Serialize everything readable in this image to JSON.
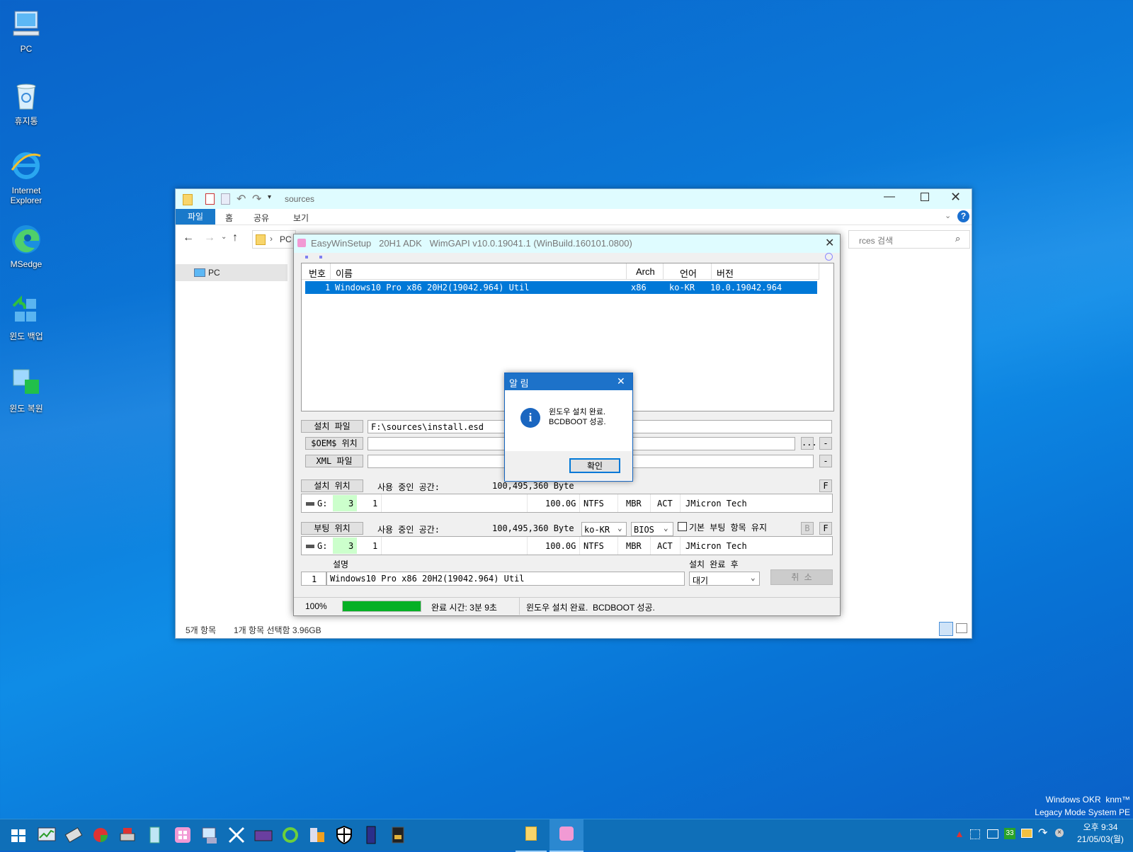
{
  "desktop": {
    "icons": [
      {
        "label": "PC"
      },
      {
        "label": "휴지통"
      },
      {
        "label": "Internet Explorer"
      },
      {
        "label": "MSedge"
      },
      {
        "label": "윈도 백업"
      },
      {
        "label": "윈도 복원"
      }
    ],
    "watermark_line1": "Windows OKR  knm™",
    "watermark_line2": "Legacy Mode System PE"
  },
  "explorer": {
    "title": "sources",
    "tabs": [
      "파일",
      "홈",
      "공유",
      "보기"
    ],
    "breadcrumb": "PC",
    "search_placeholder": "rces 검색",
    "nav_item": "PC",
    "status_count": "5개 항목",
    "status_selected": "1개 항목 선택함 3.96GB"
  },
  "ews": {
    "title": "EasyWinSetup   20H1 ADK   WimGAPI v10.0.19041.1 (WinBuild.160101.0800)",
    "columns": [
      "번호",
      "이름",
      "Arch",
      "언어",
      "버전"
    ],
    "rows": [
      {
        "num": "1",
        "name": "Windows10 Pro x86 20H2(19042.964) Util",
        "arch": "x86",
        "lang": "ko-KR",
        "ver": "10.0.19042.964"
      }
    ],
    "install_file_label": "설치 파일",
    "install_file_value": "F:\\sources\\install.esd",
    "oem_label": "$OEM$ 위치",
    "oem_browse": "...",
    "oem_clear": "-",
    "xml_label": "XML 파일",
    "xml_clear": "-",
    "install_loc_label": "설치 위치",
    "used_space_label": "사용 중인 공간:",
    "install_used_value": "100,495,360 Byte",
    "install_f_btn": "F",
    "install_disk": {
      "drive": "G:",
      "disk": "3",
      "part": "1",
      "size": "100.0G",
      "fs": "NTFS",
      "table": "MBR",
      "flag": "ACT",
      "model": "JMicron Tech"
    },
    "boot_loc_label": "부팅 위치",
    "boot_used_value": "100,495,360 Byte",
    "boot_lang": "ko-KR",
    "boot_mode": "BIOS",
    "keep_boot_label": "기본 부팅 항목 유지",
    "boot_b_btn": "B",
    "boot_f_btn": "F",
    "boot_disk": {
      "drive": "G:",
      "disk": "3",
      "part": "1",
      "size": "100.0G",
      "fs": "NTFS",
      "table": "MBR",
      "flag": "ACT",
      "model": "JMicron Tech"
    },
    "desc_label": "설명",
    "after_label": "설치 완료 후",
    "desc_num": "1",
    "desc_value": "Windows10 Pro x86 20H2(19042.964) Util",
    "after_value": "대기",
    "cancel_btn": "취 소",
    "progress_text": "100%",
    "progress_fraction": 1.0,
    "elapsed": "완료 시간: 3분 9초",
    "status_msg": "윈도우 설치 완료.  BCDBOOT 성공."
  },
  "dialog": {
    "title": "알 림",
    "line1": "윈도우 설치 완료.",
    "line2": "BCDBOOT 성공.",
    "ok": "확인"
  },
  "taskbar": {
    "tray_badge": "33",
    "time": "오후 9:34",
    "date": "21/05/03(월)"
  },
  "colors": {
    "accent": "#0078d7",
    "selection": "#0078d7",
    "progress": "#06b025",
    "taskbar": "#0f6fb8"
  }
}
